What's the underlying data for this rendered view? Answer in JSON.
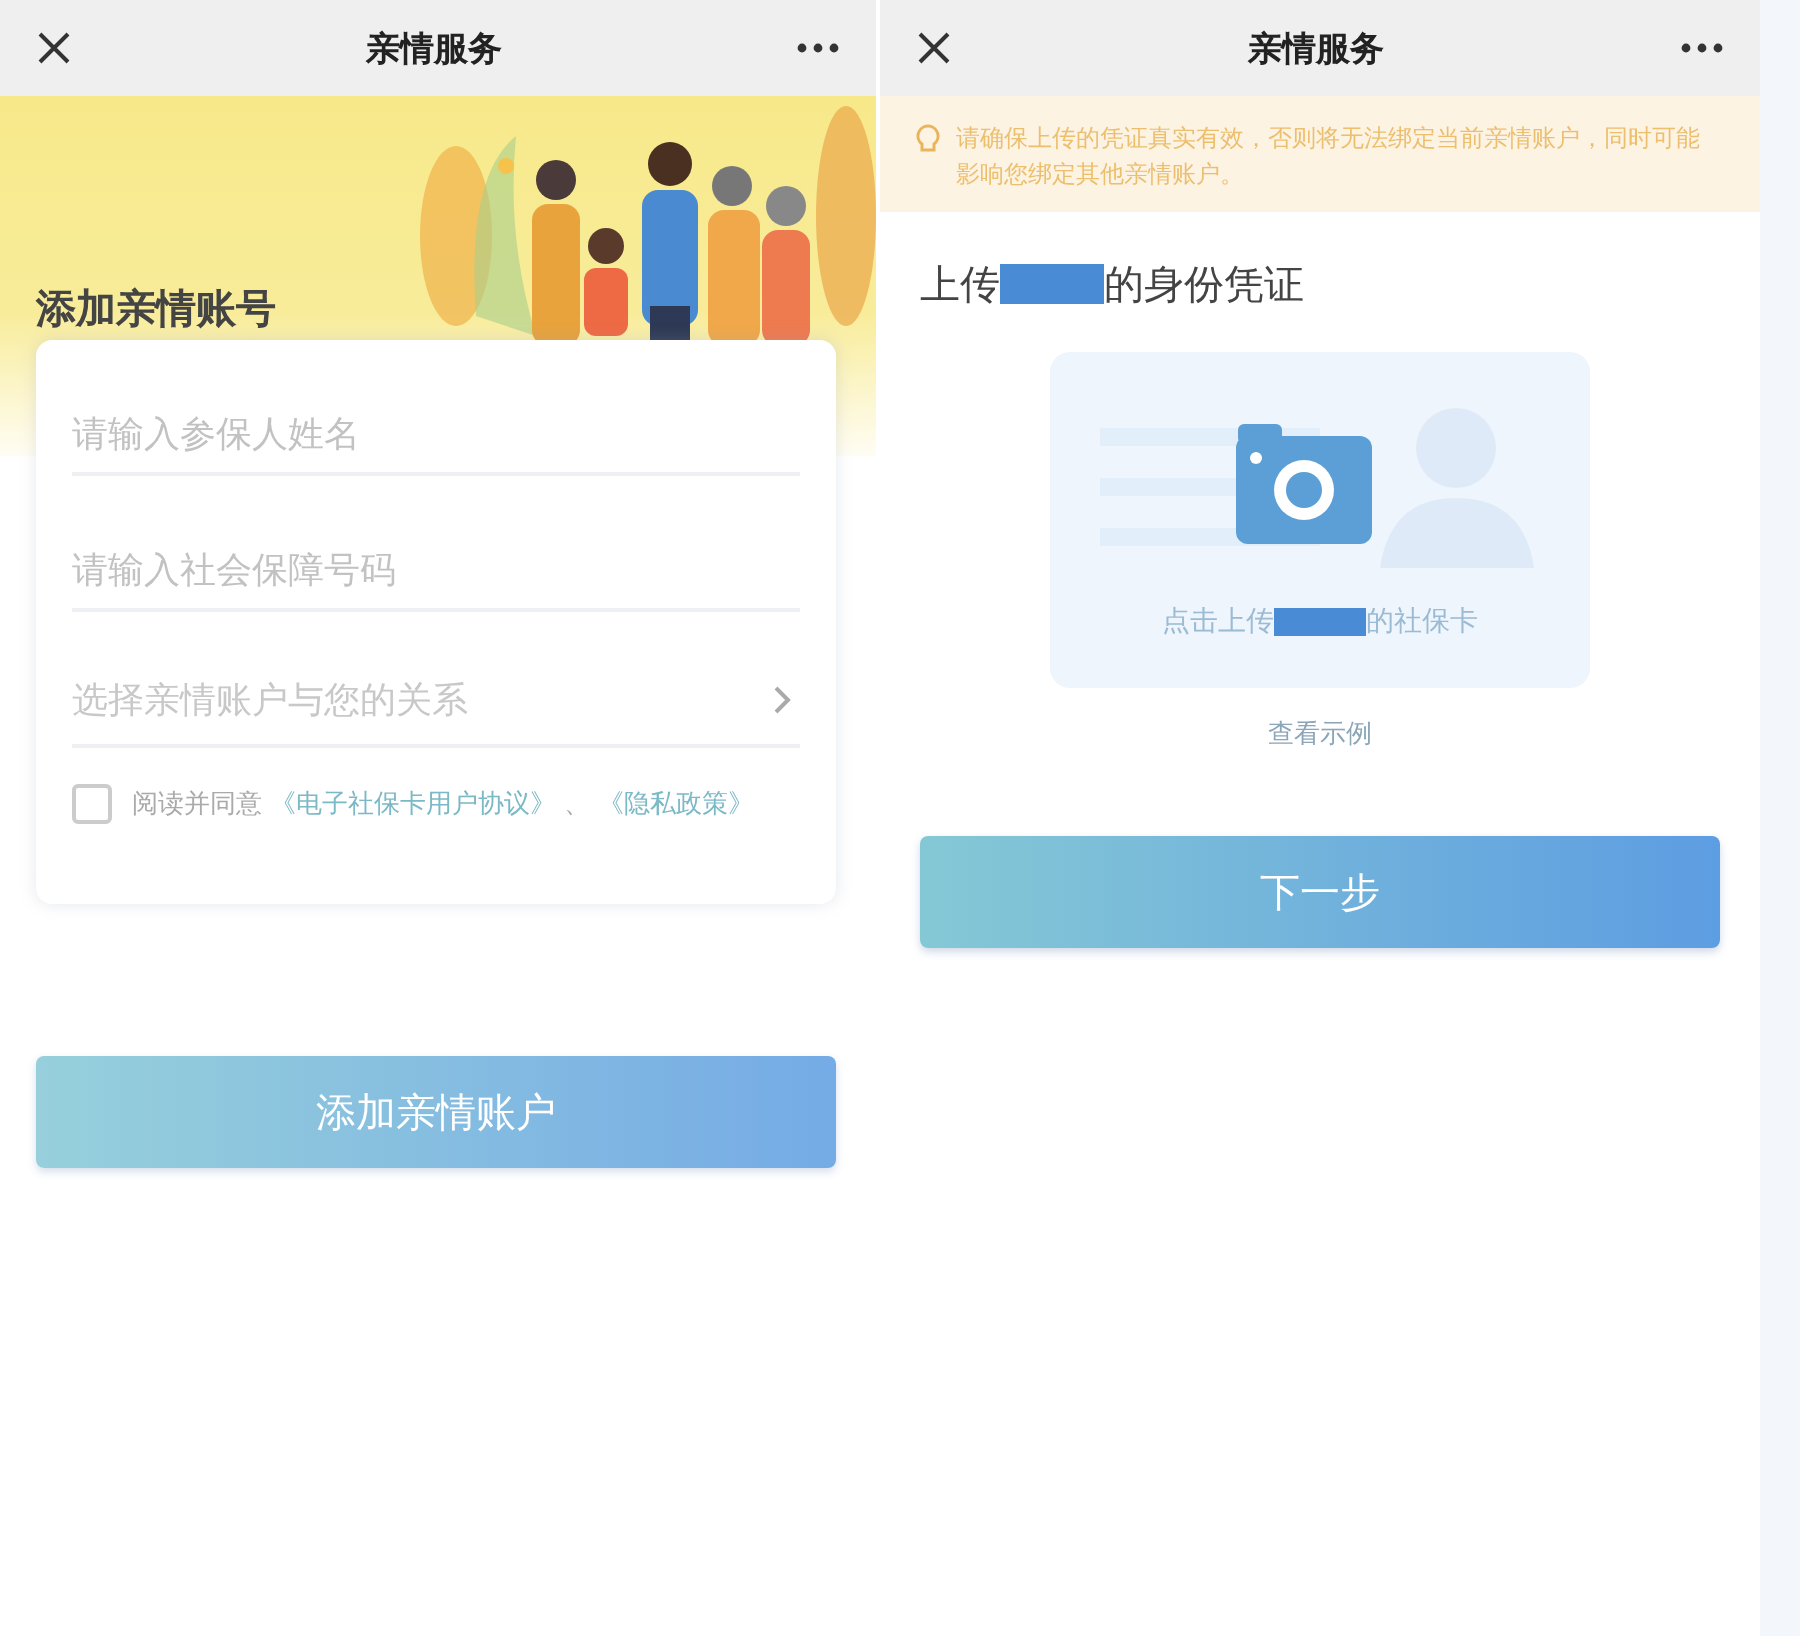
{
  "left_screen": {
    "nav": {
      "title": "亲情服务"
    },
    "banner": {
      "heading": "添加亲情账号"
    },
    "fields": [
      {
        "kind": "input",
        "placeholder": "请输入参保人姓名"
      },
      {
        "kind": "input",
        "placeholder": "请输入社会保障号码"
      },
      {
        "kind": "select",
        "placeholder": "选择亲情账户与您的关系"
      }
    ],
    "agreement": {
      "checked": false,
      "text": "阅读并同意",
      "links": [
        "《电子社保卡用户协议》",
        "《隐私政策》"
      ],
      "separator": "、"
    },
    "button": "添加亲情账户"
  },
  "right_screen": {
    "nav": {
      "title": "亲情服务"
    },
    "notice": "请确保上传的凭证真实有效，否则将无法绑定当前亲情账户，同时可能影响您绑定其他亲情账户。",
    "heading": {
      "before": "上传",
      "after": "的身份凭证"
    },
    "upload": {
      "before": "点击上传",
      "after": "的社保卡"
    },
    "example_link": "查看示例",
    "button": "下一步"
  }
}
